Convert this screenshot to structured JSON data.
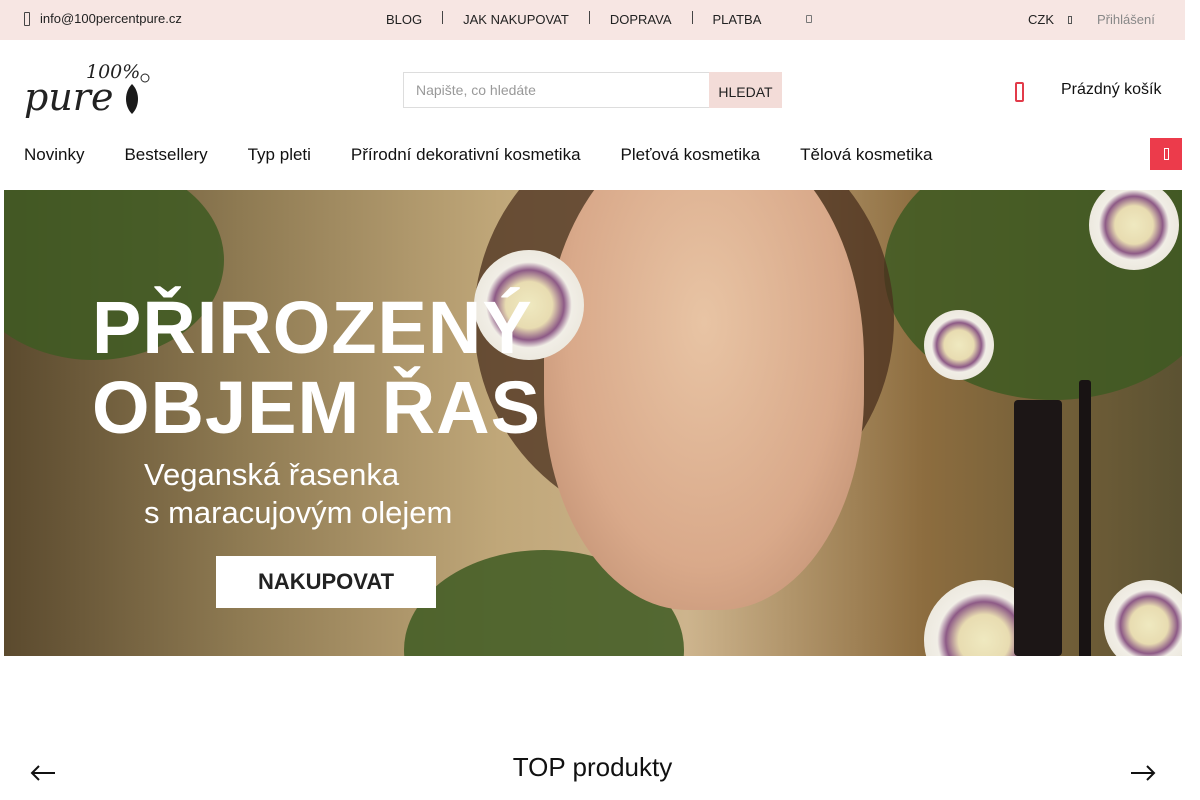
{
  "topbar": {
    "email": "info@100percentpure.cz",
    "links": [
      "BLOG",
      "JAK NAKUPOVAT",
      "DOPRAVA",
      "PLATBA"
    ],
    "currency": "CZK",
    "login": "Přihlášení"
  },
  "header": {
    "logo_text": "100% Pure",
    "search_placeholder": "Napište, co hledáte",
    "search_button": "HLEDAT",
    "cart_label": "Prázdný košík"
  },
  "mainnav": {
    "items": [
      "Novinky",
      "Bestsellery",
      "Typ pleti",
      "Přírodní dekorativní kosmetika",
      "Pleťová kosmetika",
      "Tělová kosmetika"
    ]
  },
  "hero": {
    "title_line1": "PŘIROZENÝ",
    "title_line2": "OBJEM ŘAS",
    "subtitle_line1": "Veganská řasenka",
    "subtitle_line2": "s maracujovým olejem",
    "cta": "NAKUPOVAT"
  },
  "section": {
    "title": "TOP produkty"
  },
  "colors": {
    "topbar_bg": "#f7e6e3",
    "accent_red": "#ec3b4b",
    "search_button_bg": "#f3dcd8"
  }
}
